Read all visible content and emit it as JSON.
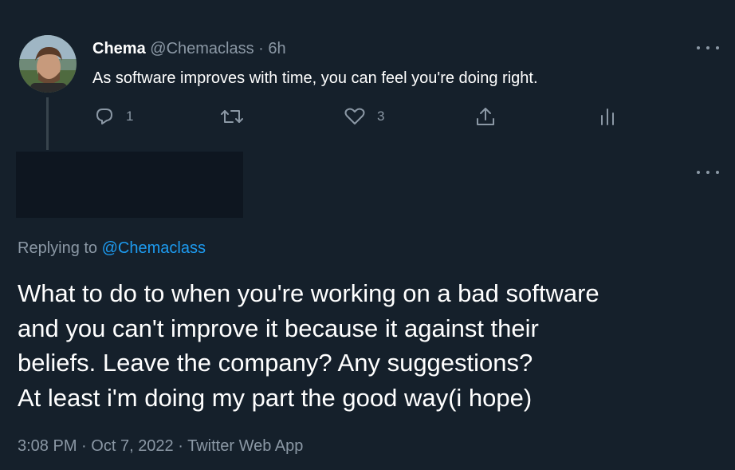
{
  "parent_tweet": {
    "author_name": "Chema",
    "author_handle": "@Chemaclass",
    "separator": "·",
    "time_ago": "6h",
    "text": "As software improves with time, you can feel you're doing right.",
    "actions": {
      "reply_icon": "reply-icon",
      "reply_count": "1",
      "retweet_icon": "retweet-icon",
      "retweet_count": "",
      "like_icon": "heart-icon",
      "like_count": "3",
      "share_icon": "share-icon",
      "analytics_icon": "analytics-icon"
    },
    "more_icon": "more-dots-icon"
  },
  "reply_tweet": {
    "more_icon": "more-dots-icon",
    "replying_prefix": "Replying to",
    "replying_handle": "@Chemaclass",
    "text_lines": [
      "What to do to when you're working on a bad software",
      "and you can't improve it because it against their",
      "beliefs. Leave the company? Any suggestions?",
      "At least i'm doing my part the good way(i hope)"
    ],
    "time": "3:08 PM",
    "date": "Oct 7, 2022",
    "client": "Twitter Web App",
    "dot": "·"
  },
  "colors": {
    "background": "#15202b",
    "primary_text": "#ffffff",
    "secondary_text": "#8b98a5",
    "link": "#1d9bf0",
    "redaction": "#0e1620"
  }
}
